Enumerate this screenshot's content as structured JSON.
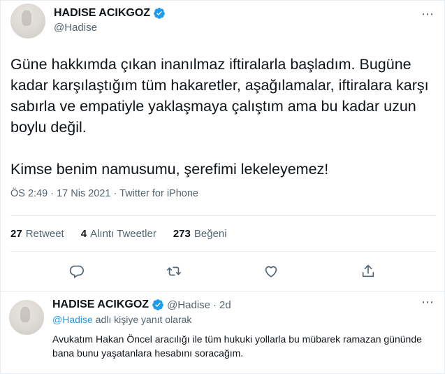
{
  "tweet": {
    "display_name": "HADISE ACIKGOZ",
    "handle": "@Hadise",
    "more_icon": "⋯",
    "text": "Güne hakkımda çıkan inanılmaz iftiralarla başladım. Bugüne kadar karşılaştığım tüm hakaretler, aşağılamalar, iftiralara karşı sabırla ve empatiyle yaklaşmaya çalıştım ama bu kadar uzun boylu değil.\n\nKimse benim namusumu, şerefimi lekeleyemez!",
    "time": "ÖS 2:49",
    "separator": "·",
    "date": "17 Nis 2021",
    "source": "Twitter for iPhone",
    "stats": {
      "retweets_count": "27",
      "retweets_label": "Retweet",
      "quotes_count": "4",
      "quotes_label": "Alıntı Tweetler",
      "likes_count": "273",
      "likes_label": "Beğeni"
    }
  },
  "reply": {
    "display_name": "HADISE ACIKGOZ",
    "handle": "@Hadise",
    "separator": "·",
    "age": "2d",
    "more_icon": "⋯",
    "reply_to_mention": "@Hadise",
    "reply_to_suffix": "adlı kişiye yanıt olarak",
    "text": "Avukatım Hakan Öncel aracılığı ile tüm hukuki yollarla bu mübarek ramazan gününde bana bunu yaşatanlara hesabını soracağım."
  },
  "icons": {
    "verified": "verified-badge-icon",
    "reply": "reply-icon",
    "retweet": "retweet-icon",
    "like": "heart-icon",
    "share": "share-icon"
  },
  "colors": {
    "verified": "#1d9bf0",
    "secondary_text": "#536471",
    "mention": "#1d9bf0",
    "divider": "#e6ecf0"
  }
}
